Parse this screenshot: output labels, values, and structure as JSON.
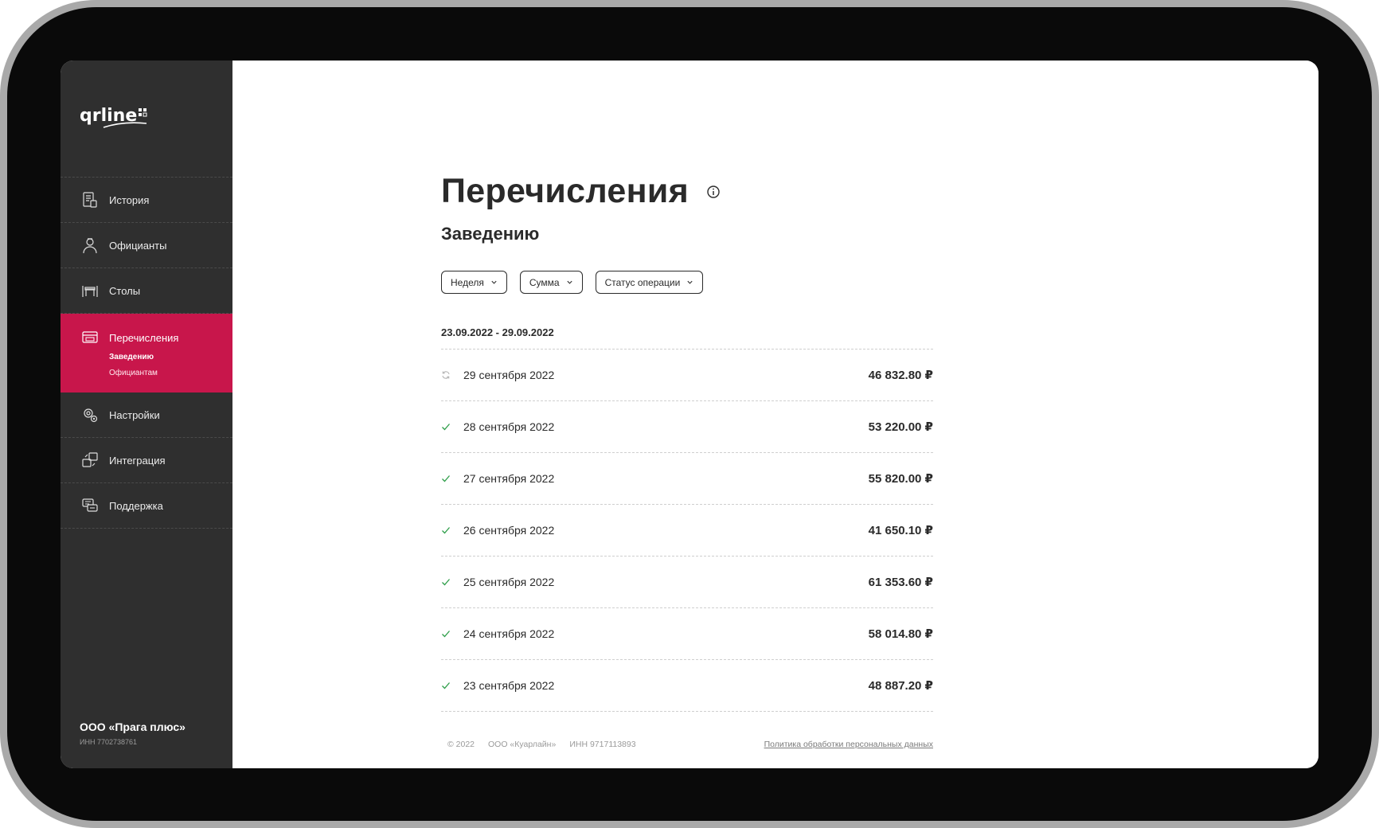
{
  "app": {
    "logo_text": "qrline"
  },
  "sidebar": {
    "items": [
      {
        "label": "История",
        "icon": "history-icon"
      },
      {
        "label": "Официанты",
        "icon": "waiter-icon"
      },
      {
        "label": "Столы",
        "icon": "tables-icon"
      },
      {
        "label": "Перечисления",
        "icon": "transfers-icon",
        "active": true
      },
      {
        "label": "Настройки",
        "icon": "settings-icon"
      },
      {
        "label": "Интеграция",
        "icon": "integration-icon"
      },
      {
        "label": "Поддержка",
        "icon": "support-icon"
      }
    ],
    "subitems": [
      {
        "label": "Заведению",
        "current": true
      },
      {
        "label": "Официантам",
        "current": false
      }
    ],
    "company": {
      "name": "ООО «Прага плюс»",
      "inn": "ИНН 7702738761"
    }
  },
  "main": {
    "title": "Перечисления",
    "subtitle": "Заведению",
    "filters": [
      {
        "label": "Неделя"
      },
      {
        "label": "Сумма"
      },
      {
        "label": "Статус операции"
      }
    ],
    "range": "23.09.2022 - 29.09.2022",
    "rows": [
      {
        "date": "29 сентября 2022",
        "amount": "46 832.80 ₽",
        "status": "pending"
      },
      {
        "date": "28 сентября 2022",
        "amount": "53 220.00 ₽",
        "status": "done"
      },
      {
        "date": "27 сентября 2022",
        "amount": "55 820.00 ₽",
        "status": "done"
      },
      {
        "date": "26 сентября 2022",
        "amount": "41 650.10 ₽",
        "status": "done"
      },
      {
        "date": "25 сентября 2022",
        "amount": "61 353.60 ₽",
        "status": "done"
      },
      {
        "date": "24 сентября 2022",
        "amount": "58 014.80 ₽",
        "status": "done"
      },
      {
        "date": "23 сентября 2022",
        "amount": "48 887.20 ₽",
        "status": "done"
      }
    ]
  },
  "footer": {
    "copyright": "© 2022",
    "company": "ООО «Куарлайн»",
    "inn": "ИНН 9717113893",
    "policy": "Политика обработки персональных данных"
  },
  "colors": {
    "accent": "#c8164b",
    "sidebar_bg": "#2f2f2f",
    "success": "#2e9e49",
    "pending": "#b5b5b5"
  }
}
